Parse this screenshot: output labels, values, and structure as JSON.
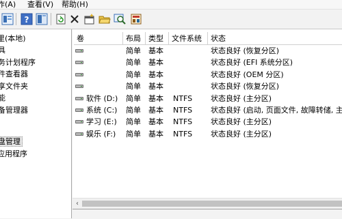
{
  "menubar": {
    "items": [
      "作(A)",
      "查看(V)",
      "帮助(H)"
    ]
  },
  "toolbar": {
    "buttons": [
      "properties-icon",
      "help-icon",
      "refresh-icon",
      "delete-icon",
      "new-icon",
      "open-icon",
      "zoom-icon",
      "settings-icon"
    ]
  },
  "tree": {
    "items": [
      "里(本地)",
      "具",
      "务计划程序",
      "件查看器",
      "享文件夹",
      "能",
      "备管理器",
      "",
      "盘管理",
      "应用程序"
    ]
  },
  "table": {
    "columns": [
      "卷",
      "布局",
      "类型",
      "文件系统",
      "状态"
    ],
    "rows": [
      {
        "volume": "",
        "layout": "简单",
        "type": "基本",
        "fs": "",
        "status": "状态良好 (恢复分区)"
      },
      {
        "volume": "",
        "layout": "简单",
        "type": "基本",
        "fs": "",
        "status": "状态良好 (EFI 系统分区)"
      },
      {
        "volume": "",
        "layout": "简单",
        "type": "基本",
        "fs": "",
        "status": "状态良好 (OEM 分区)"
      },
      {
        "volume": "",
        "layout": "简单",
        "type": "基本",
        "fs": "",
        "status": "状态良好 (恢复分区)"
      },
      {
        "volume": "软件 (D:)",
        "layout": "简单",
        "type": "基本",
        "fs": "NTFS",
        "status": "状态良好 (主分区)"
      },
      {
        "volume": "系统 (C:)",
        "layout": "简单",
        "type": "基本",
        "fs": "NTFS",
        "status": "状态良好 (启动, 页面文件, 故障转储, 主"
      },
      {
        "volume": "学习 (E:)",
        "layout": "简单",
        "type": "基本",
        "fs": "NTFS",
        "status": "状态良好 (主分区)"
      },
      {
        "volume": "娱乐 (F:)",
        "layout": "简单",
        "type": "基本",
        "fs": "NTFS",
        "status": "状态良好 (主分区)"
      }
    ]
  },
  "scroll": {
    "left_arrow": "‹"
  },
  "colors": {
    "accent": "#2b6cd4"
  }
}
